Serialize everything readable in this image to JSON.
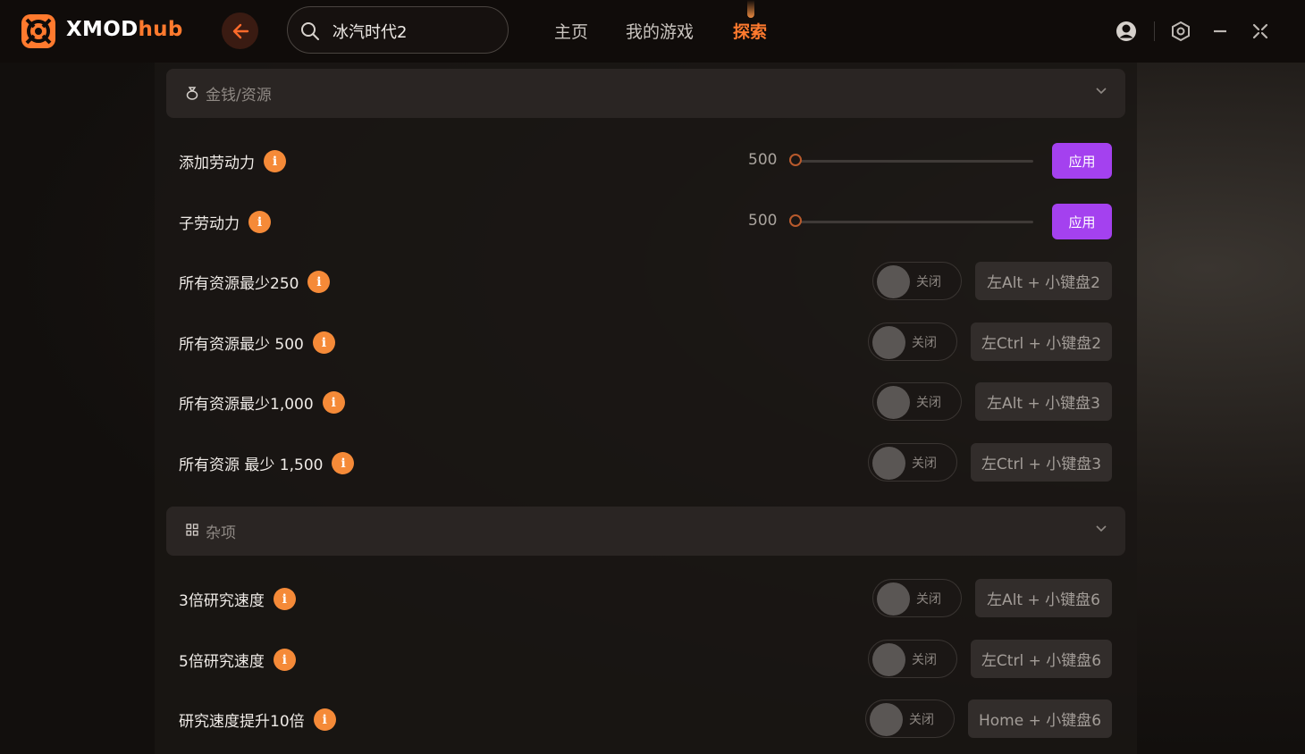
{
  "app": {
    "brand_main": "XMOD",
    "brand_accent": "hub"
  },
  "search": {
    "value": "冰汽时代2"
  },
  "nav": {
    "home": "主页",
    "my_games": "我的游戏",
    "explore": "探索"
  },
  "sections": [
    {
      "title": "金钱/资源",
      "rows": [
        {
          "label": "添加劳动力",
          "slider_value": "500",
          "apply": "应用"
        },
        {
          "label": "子劳动力",
          "slider_value": "500",
          "apply": "应用"
        },
        {
          "label": "所有资源最少250",
          "toggle": "关闭",
          "hotkey": "左Alt + 小键盘2"
        },
        {
          "label": "所有资源最少 500",
          "toggle": "关闭",
          "hotkey": "左Ctrl + 小键盘2"
        },
        {
          "label": "所有资源最少1,000",
          "toggle": "关闭",
          "hotkey": "左Alt + 小键盘3"
        },
        {
          "label": "所有资源 最少 1,500",
          "toggle": "关闭",
          "hotkey": "左Ctrl + 小键盘3"
        }
      ]
    },
    {
      "title": "杂项",
      "rows": [
        {
          "label": "3倍研究速度",
          "toggle": "关闭",
          "hotkey": "左Alt + 小键盘6"
        },
        {
          "label": "5倍研究速度",
          "toggle": "关闭",
          "hotkey": "左Ctrl + 小键盘6"
        },
        {
          "label": "研究速度提升10倍",
          "toggle": "关闭",
          "hotkey": "Home + 小键盘6"
        }
      ]
    }
  ],
  "colors": {
    "accent_orange": "#ff7a2e",
    "apply_purple": "#a441ef",
    "info_orange": "#f58a38"
  },
  "icons": [
    "logo-icon",
    "back-arrow-icon",
    "search-icon",
    "user-icon",
    "settings-icon",
    "minimize-icon",
    "close-icon",
    "money-bag-icon",
    "grid-icon",
    "chevron-down-icon",
    "info-icon"
  ]
}
